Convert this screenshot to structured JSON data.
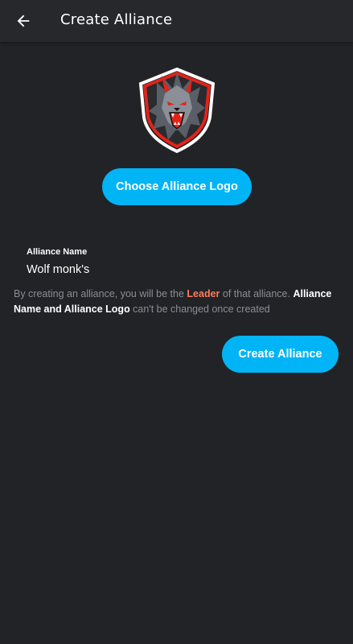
{
  "app_bar": {
    "title": "Create Alliance",
    "back_icon": "arrow-left-icon"
  },
  "logo": {
    "icon": "wolf-emblem-logo",
    "colors": {
      "accent": "#e2231a",
      "fur": "#5a5e66",
      "fur_light": "#8a8f98",
      "outline": "#ffffff"
    }
  },
  "buttons": {
    "choose_logo": "Choose Alliance Logo",
    "create_alliance": "Create Alliance"
  },
  "form": {
    "alliance_name_label": "Alliance Name",
    "alliance_name_value": "Wolf monk's"
  },
  "info": {
    "part1": "By creating an alliance, you will be the ",
    "leader": "Leader",
    "part2": " of that alliance. ",
    "strong": "Alliance Name and Alliance Logo",
    "part3": " can't be changed once created"
  },
  "colors": {
    "background": "#222327",
    "app_bar": "#27282c",
    "primary_button": "#00b4f6",
    "leader_highlight": "#ff7a5c",
    "muted_text": "#8b8d93"
  }
}
